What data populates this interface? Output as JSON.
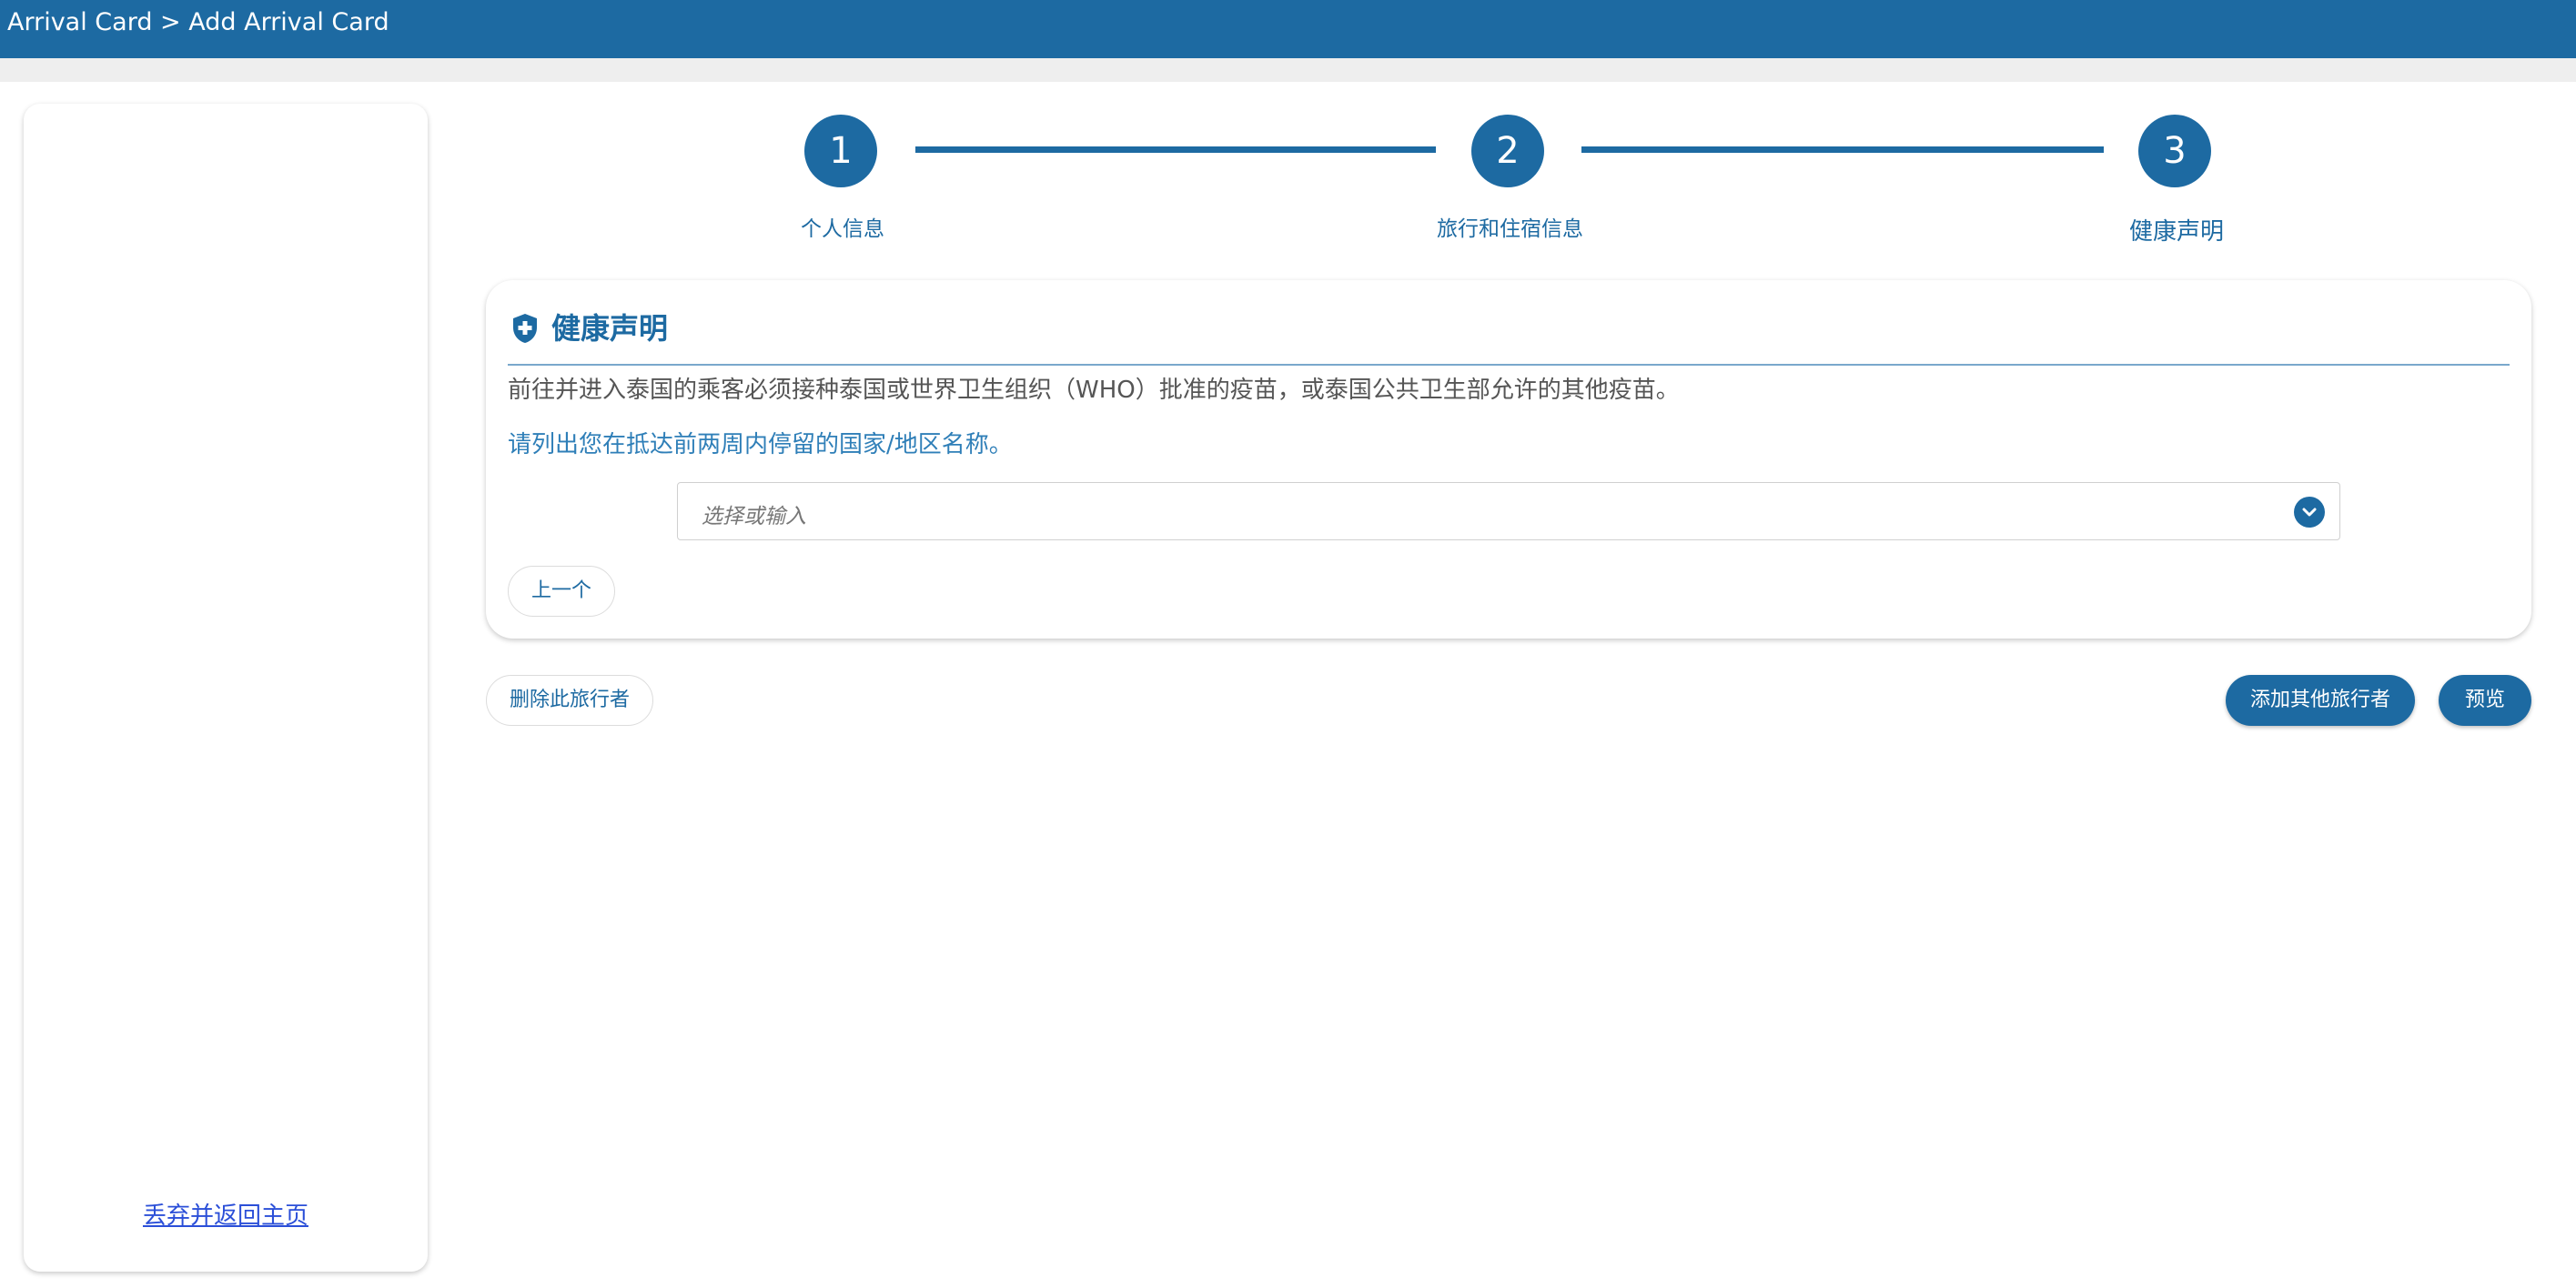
{
  "header": {
    "breadcrumb": "Arrival Card > Add Arrival Card"
  },
  "sidebar": {
    "discard_link": "丢弃并返回主页"
  },
  "stepper": {
    "steps": [
      {
        "number": "1",
        "label": "个人信息"
      },
      {
        "number": "2",
        "label": "旅行和住宿信息"
      },
      {
        "number": "3",
        "label": "健康声明"
      }
    ],
    "current_step": 3
  },
  "health_card": {
    "icon": "shield-plus-icon",
    "title": "健康声明",
    "notice": "前往并进入泰国的乘客必须接种泰国或世界卫生组织（WHO）批准的疫苗，或泰国公共卫生部允许的其他疫苗。",
    "question": "请列出您在抵达前两周内停留的国家/地区名称。",
    "country_select": {
      "placeholder": "选择或输入",
      "value": ""
    },
    "prev_button": "上一个"
  },
  "actions": {
    "delete_traveler": "删除此旅行者",
    "add_traveler": "添加其他旅行者",
    "preview": "预览"
  },
  "colors": {
    "primary": "#1d6aa2",
    "link": "#2b4fd8"
  }
}
